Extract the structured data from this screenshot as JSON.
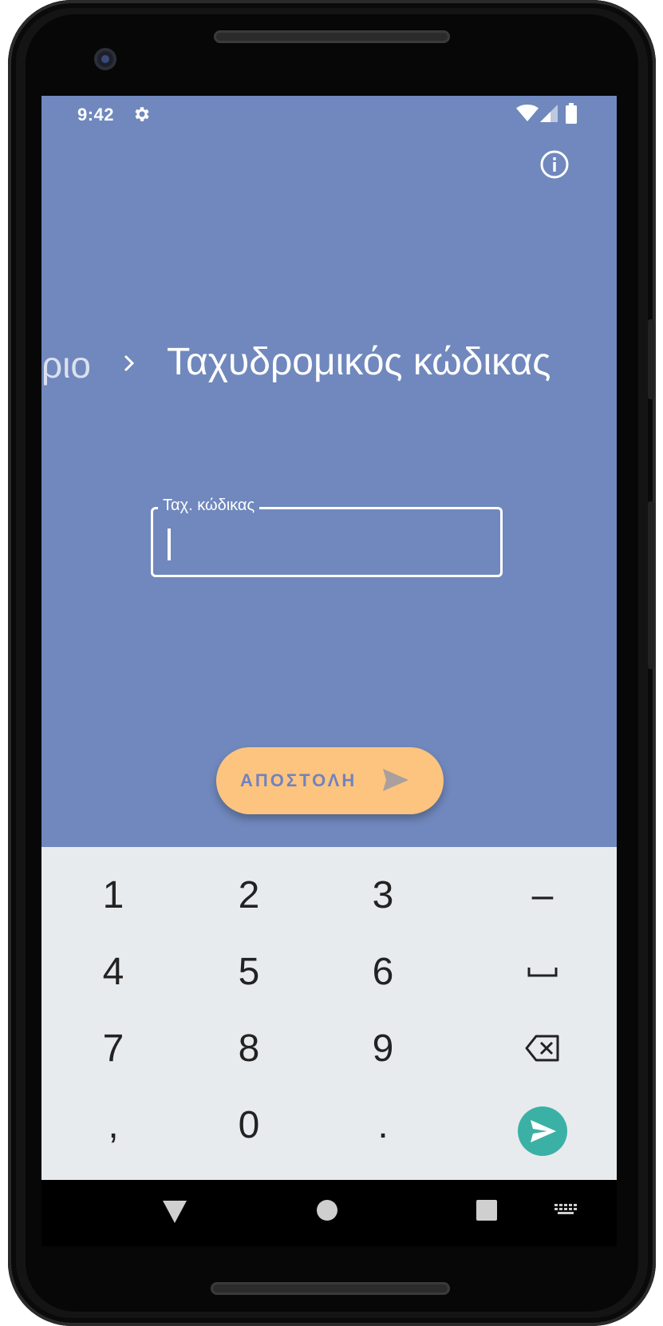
{
  "status_bar": {
    "time": "9:42",
    "icons": [
      "gear-icon",
      "wifi-icon",
      "signal-icon",
      "battery-icon"
    ]
  },
  "header": {
    "info_icon": "info-icon"
  },
  "breadcrumb": {
    "previous": "ριο",
    "current": "Ταχυδρομικός κώδικας"
  },
  "postal_field": {
    "label": "Ταχ. κώδικας",
    "value": ""
  },
  "send_button": {
    "label": "ΑΠΟΣΤΟΛΗ",
    "icon": "send-icon"
  },
  "keyboard": {
    "rows": [
      [
        "1",
        "2",
        "3",
        "–"
      ],
      [
        "4",
        "5",
        "6",
        "space"
      ],
      [
        "7",
        "8",
        "9",
        "backspace"
      ],
      [
        ",",
        "0",
        ".",
        "enter"
      ]
    ],
    "k1": "1",
    "k2": "2",
    "k3": "3",
    "kdash": "–",
    "k4": "4",
    "k5": "5",
    "k6": "6",
    "k7": "7",
    "k8": "8",
    "k9": "9",
    "kcomma": ",",
    "k0": "0",
    "kdot": "."
  },
  "nav_bar": {
    "icons": [
      "back-icon",
      "home-icon",
      "recents-icon",
      "keyboard-switch-icon"
    ]
  },
  "colors": {
    "background": "#7088bd",
    "button": "#fcc47f",
    "button_text": "#6f83bf",
    "keyboard_bg": "#e8ebee",
    "enter_key": "#3bb1a6"
  }
}
